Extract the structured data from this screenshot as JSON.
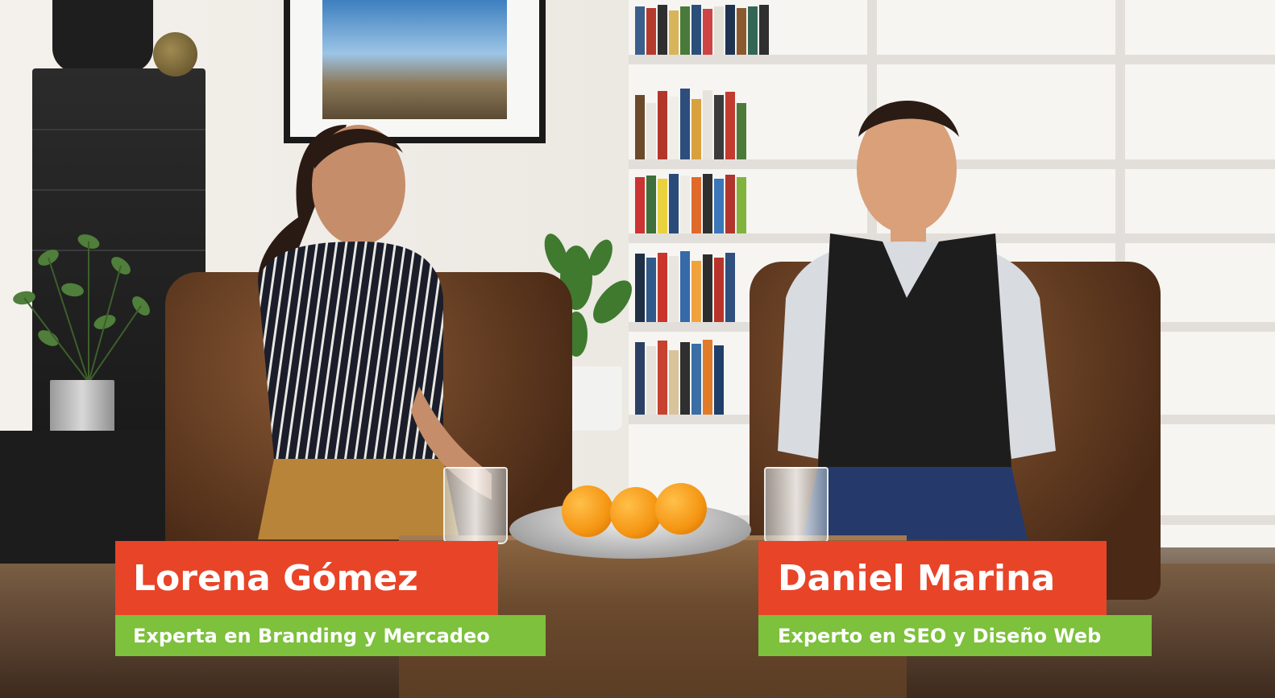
{
  "scene": {
    "description_colors": {
      "name_bar": "#e84428",
      "title_bar": "#7dc13c",
      "text": "#ffffff"
    }
  },
  "lower_thirds": {
    "left": {
      "name": "Lorena Gómez",
      "title": "Experta en Branding y Mercadeo"
    },
    "right": {
      "name": "Daniel Marina",
      "title": "Experto en SEO y Diseño Web"
    }
  }
}
